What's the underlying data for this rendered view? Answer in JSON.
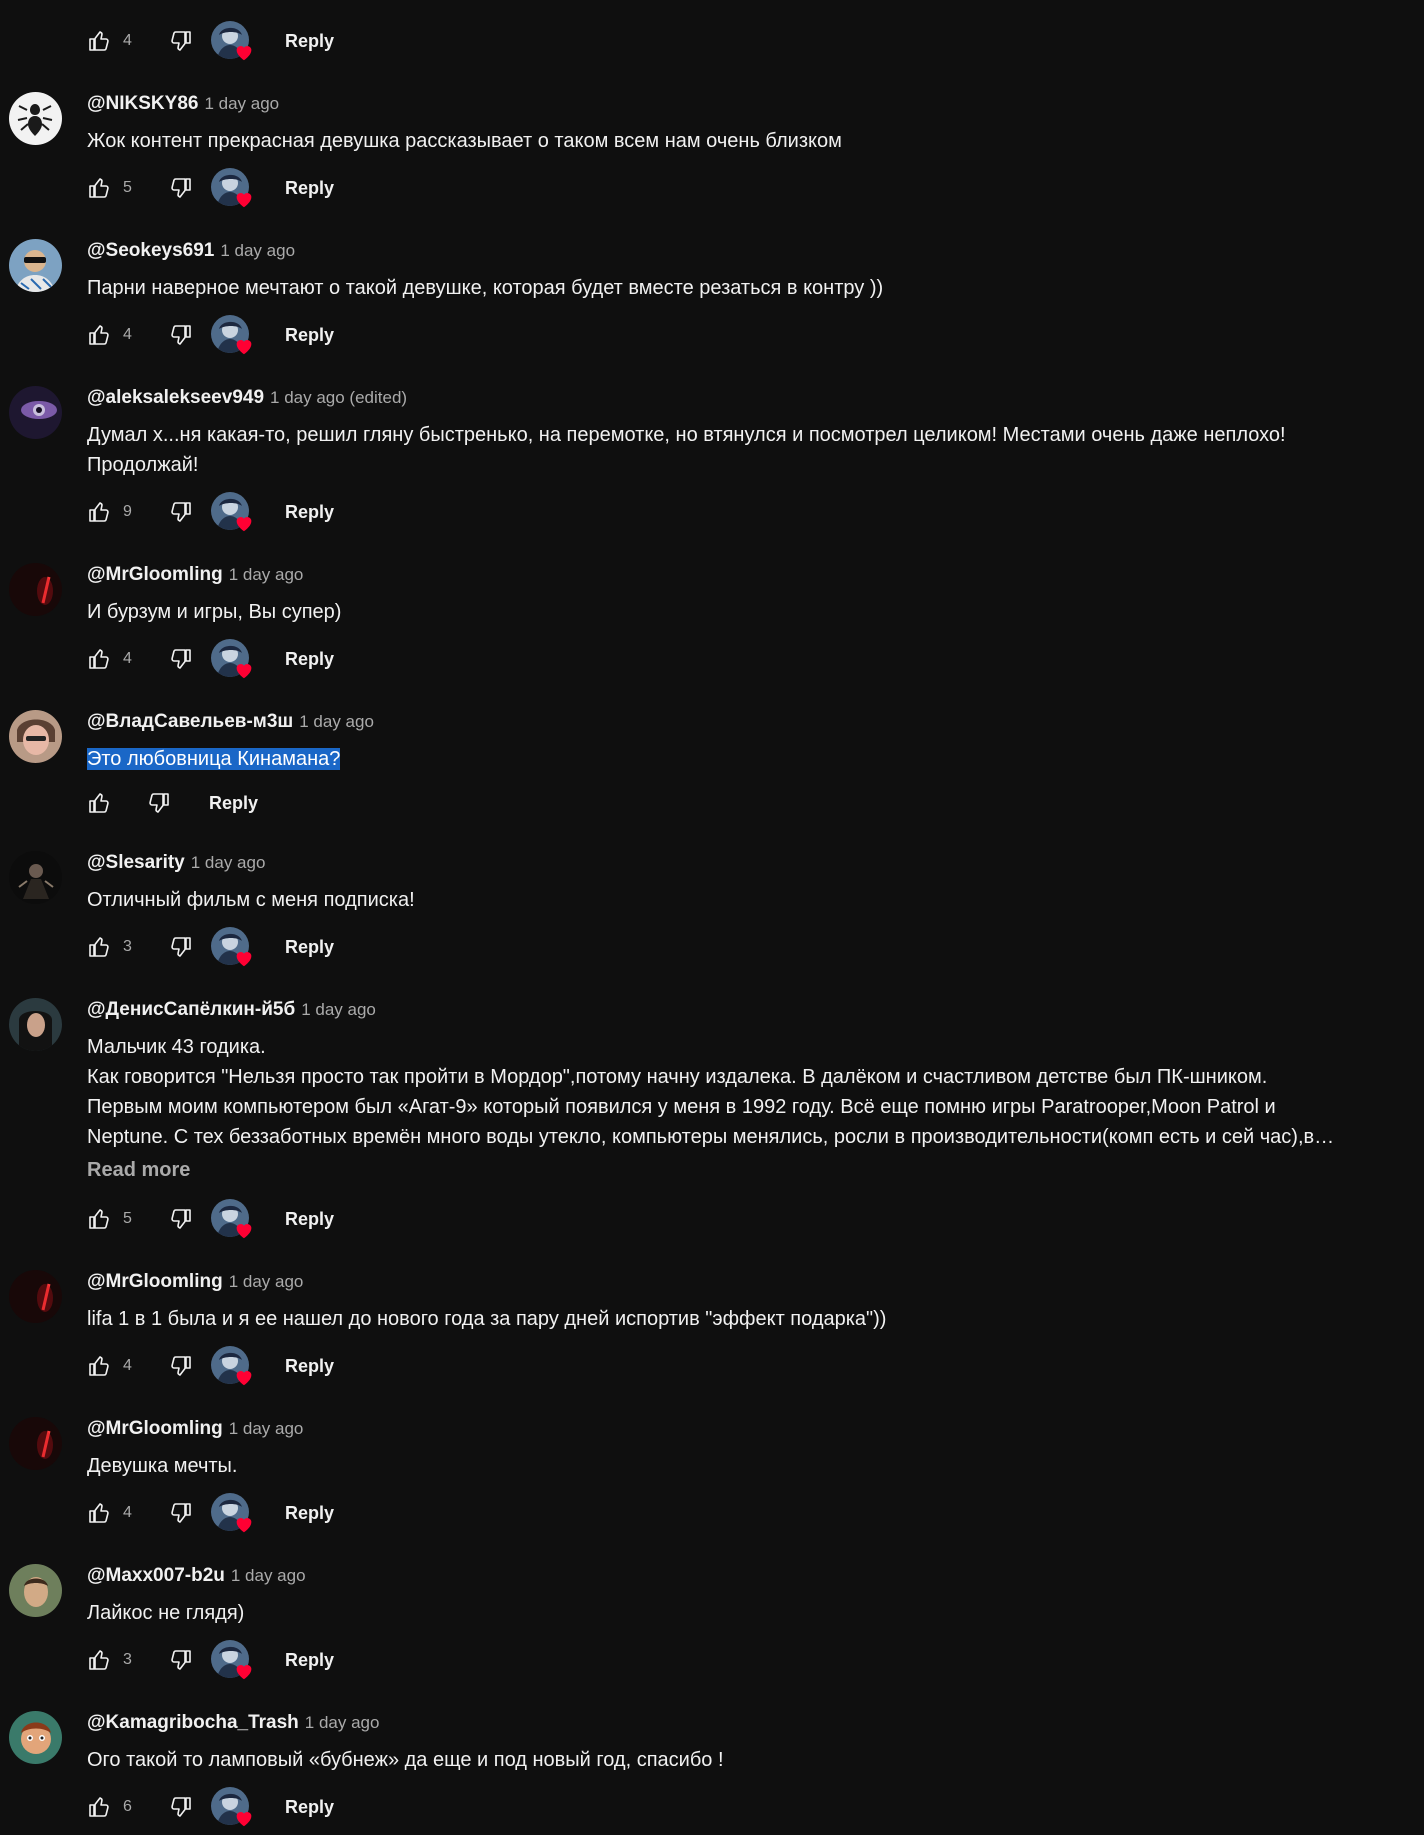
{
  "colors": {
    "background": "#0f0f0f",
    "selection": "#1a67c7",
    "heart": "#ff0033"
  },
  "top_row": {
    "likes": "4",
    "reply_label": "Reply"
  },
  "comments": [
    {
      "author": "@NIKSKY86",
      "time": "1 day ago",
      "text": "Жок контент прекрасная девушка рассказывает о таком всем нам очень близком",
      "likes": "5",
      "reply_label": "Reply",
      "avatar": "scorpion-avatar"
    },
    {
      "author": "@Seokeys691",
      "time": "1 day ago",
      "text": "Парни наверное мечтают о такой девушке, которая будет вместе резаться в контру ))",
      "likes": "4",
      "reply_label": "Reply",
      "avatar": "sunglasses-man-avatar"
    },
    {
      "author": "@aleksalekseev949",
      "time": "1 day ago (edited)",
      "text": "Думал х...ня какая-то, решил гляну быстренько, на перемотке, но втянулся и посмотрел целиком! Местами очень даже неплохо!\nПродолжай!",
      "likes": "9",
      "reply_label": "Reply",
      "avatar": "purple-eye-avatar"
    },
    {
      "author": "@MrGloomling",
      "time": "1 day ago",
      "text": "И бурзум и игры, Вы супер)",
      "likes": "4",
      "reply_label": "Reply",
      "avatar": "red-glow-avatar"
    },
    {
      "author": "@ВладСавельев-м3ш",
      "time": "1 day ago",
      "text": "Это любовница Кинамана?",
      "likes": "",
      "reply_label": "Reply",
      "avatar": "face-avatar"
    },
    {
      "author": "@Slesarity",
      "time": "1 day ago",
      "text": "Отличный фильм с меня подписка!",
      "likes": "3",
      "reply_label": "Reply",
      "avatar": "dark-figure-avatar"
    },
    {
      "author": "@ДенисСапёлкин-й5б",
      "time": "1 day ago",
      "text_lines": [
        "Мальчик 43 годика.",
        "Как говорится \"Нельзя просто так пройти в Мордор\",потому начну издалека. В далёком и счастливом детстве был ПК-шником.",
        "Первым моим компьютером был «Агат-9» который появился у меня в 1992 году. Всё еще помню игры Paratrooper,Moon Patrol и",
        "Neptune. С тех беззаботных времён много воды утекло, компьютеры менялись, росли в производительности(комп есть и сей час),в…"
      ],
      "read_more": "Read more",
      "likes": "5",
      "reply_label": "Reply",
      "avatar": "long-hair-avatar"
    },
    {
      "author": "@MrGloomling",
      "time": "1 day ago",
      "text": "lifa 1 в 1 была и я ее нашел до нового года за пару дней испортив \"эффект подарка\"))",
      "likes": "4",
      "reply_label": "Reply",
      "avatar": "red-glow-avatar"
    },
    {
      "author": "@MrGloomling",
      "time": "1 day ago",
      "text": "Девушка мечты.",
      "likes": "4",
      "reply_label": "Reply",
      "avatar": "red-glow-avatar"
    },
    {
      "author": "@Maxx007-b2u",
      "time": "1 day ago",
      "text": "Лайкос не глядя)",
      "likes": "3",
      "reply_label": "Reply",
      "avatar": "man-portrait-avatar"
    },
    {
      "author": "@Kamagribocha_Trash",
      "time": "1 day ago",
      "text": "Ого такой то ламповый «бубнеж» да еще и под новый год, спасибо !",
      "likes": "6",
      "reply_label": "Reply",
      "avatar": "cartoon-avatar"
    }
  ]
}
